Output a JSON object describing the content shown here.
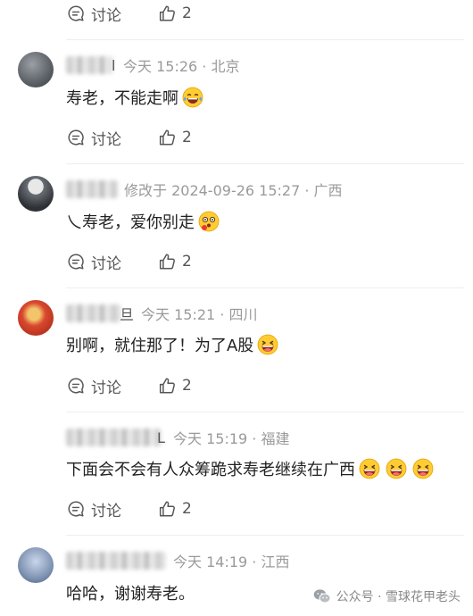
{
  "comments": [
    {
      "time": "今天 15:26 · 北京",
      "trail": "l",
      "text": "寿老，不能走啊",
      "discuss_label": "讨论",
      "like_count": "2"
    },
    {
      "time": "修改于 2024-09-26 15:27 · 广西",
      "trail": "",
      "text": "乀寿老，爱你别走",
      "discuss_label": "讨论",
      "like_count": "2"
    },
    {
      "time": "今天 15:21 · 四川",
      "trail": "旦",
      "text": "别啊，就住那了！为了A股",
      "discuss_label": "讨论",
      "like_count": "2"
    },
    {
      "time": "今天 15:19 · 福建",
      "trail": "L",
      "text": "下面会不会有人众筹跪求寿老继续在广西",
      "discuss_label": "讨论",
      "like_count": "2"
    },
    {
      "time": "今天 14:19 · 江西",
      "trail": "",
      "text": "哈哈，谢谢寿老。"
    }
  ],
  "top_actions": {
    "discuss_label": "讨论",
    "like_count": "2"
  },
  "footer": {
    "source": "公众号 · 雪球花甲老头"
  },
  "icons": [
    "comment-icon",
    "thumb-up-icon",
    "laughing-crying-emoji-icon",
    "dizzy-emoji-icon",
    "grinning-emoji-icon",
    "wechat-icon"
  ]
}
